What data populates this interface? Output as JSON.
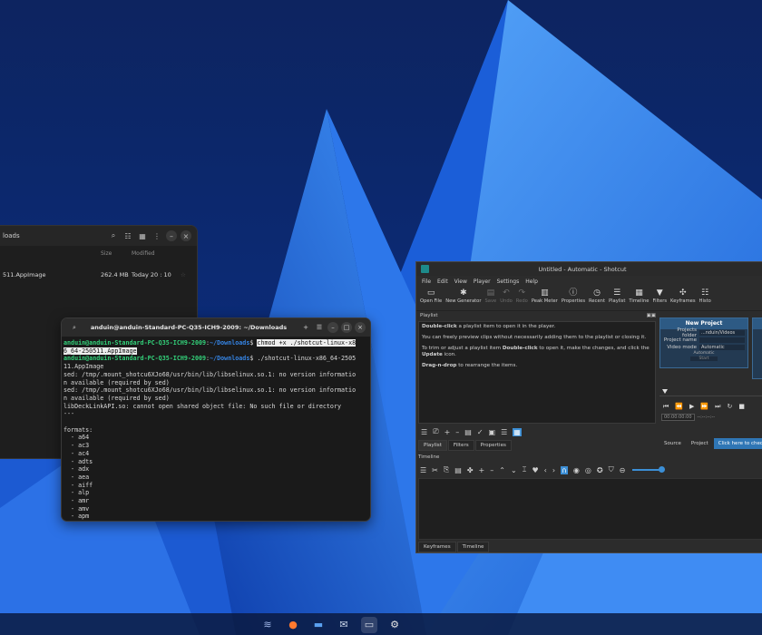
{
  "file_manager": {
    "path": "loads",
    "columns": {
      "size": "Size",
      "modified": "Modified"
    },
    "row": {
      "name": "511.AppImage",
      "size": "262.4 MB",
      "modified": "Today 20 : 10"
    }
  },
  "terminal": {
    "title": "anduin@anduin-Standard-PC-Q35-ICH9-2009: ~/Downloads",
    "prompt_user": "anduin@anduin-Standard-PC-Q35-ICH9-2009",
    "prompt_sep": ":",
    "prompt_dir": "~/Downloads",
    "prompt_end": "$ ",
    "cmd1_a": "chmod +x ./shotcut-linux-x8",
    "cmd1_b": "6_64-250511.AppImage",
    "cmd2_a": "./shotcut-linux-x86_64-2505",
    "cmd2_b": "11.AppImage",
    "output_lines": [
      "sed: /tmp/.mount_shotcu6XJo68/usr/bin/lib/libselinux.so.1: no version informatio",
      "n available (required by sed)",
      "sed: /tmp/.mount_shotcu6XJo68/usr/bin/lib/libselinux.so.1: no version informatio",
      "n available (required by sed)",
      "libDeckLinkAPI.so: cannot open shared object file: No such file or directory",
      "---",
      "",
      "formats:",
      "  - a64",
      "  - ac3",
      "  - ac4",
      "  - adts",
      "  - adx",
      "  - aea",
      "  - aiff",
      "  - alp",
      "  - amr",
      "  - amv",
      "  - apm",
      "  - apng",
      "  - aptx"
    ]
  },
  "shotcut": {
    "title": "Untitled - Automatic - Shotcut",
    "menu": [
      "File",
      "Edit",
      "View",
      "Player",
      "Settings",
      "Help"
    ],
    "toolbar": [
      {
        "icon": "open-file-icon",
        "glyph": "▭",
        "label": "Open File",
        "dim": false
      },
      {
        "icon": "new-generator-icon",
        "glyph": "✱",
        "label": "New Generator",
        "dim": false
      },
      {
        "icon": "save-icon",
        "glyph": "▤",
        "label": "Save",
        "dim": true
      },
      {
        "icon": "undo-icon",
        "glyph": "↶",
        "label": "Undo",
        "dim": true
      },
      {
        "icon": "redo-icon",
        "glyph": "↷",
        "label": "Redo",
        "dim": true
      },
      {
        "icon": "peak-meter-icon",
        "glyph": "▥",
        "label": "Peak Meter",
        "dim": false
      },
      {
        "icon": "properties-icon",
        "glyph": "ⓘ",
        "label": "Properties",
        "dim": false
      },
      {
        "icon": "recent-icon",
        "glyph": "◷",
        "label": "Recent",
        "dim": false
      },
      {
        "icon": "playlist-icon",
        "glyph": "☰",
        "label": "Playlist",
        "dim": false
      },
      {
        "icon": "timeline-icon",
        "glyph": "▦",
        "label": "Timeline",
        "dim": false
      },
      {
        "icon": "filters-icon",
        "glyph": "▼",
        "label": "Filters",
        "dim": false
      },
      {
        "icon": "keyframes-icon",
        "glyph": "✣",
        "label": "Keyframes",
        "dim": false
      },
      {
        "icon": "history-icon",
        "glyph": "☷",
        "label": "Histo",
        "dim": false
      }
    ],
    "playlist": {
      "header": "Playlist",
      "p1_bold": "Double-click",
      "p1_rest": " a playlist item to open it in the player.",
      "p2": "You can freely preview clips without necessarily adding them to the playlist or closing it.",
      "p3_a": "To trim or adjust a playlist item ",
      "p3_bold": "Double-click",
      "p3_b": " to open it, make the changes, and click the ",
      "p3_bold2": "Update",
      "p3_c": " icon.",
      "p4_bold": "Drag-n-drop",
      "p4_rest": " to rearrange the items.",
      "tabs": [
        "Playlist",
        "Filters",
        "Properties"
      ]
    },
    "new_project": {
      "title": "New Project",
      "folder_label": "Projects folder",
      "folder_value": "...nduin/Videos",
      "name_label": "Project name",
      "name_value": "",
      "mode_label": "Video mode",
      "mode_value": "Automatic",
      "mini_value": "Automatic",
      "start_label": "Start"
    },
    "player": {
      "timecode": "00:00:00:00",
      "duration": "--:--:--:--"
    },
    "source_tabs": [
      "Source",
      "Project"
    ],
    "click_cta": "Click here to chec",
    "timeline_header": "Timeline",
    "bottom_tabs": [
      "Keyframes",
      "Timeline"
    ]
  },
  "taskbar": [
    "files-stack-icon",
    "firefox-icon",
    "folder-icon",
    "mail-icon",
    "terminal-icon",
    "settings-icon"
  ]
}
